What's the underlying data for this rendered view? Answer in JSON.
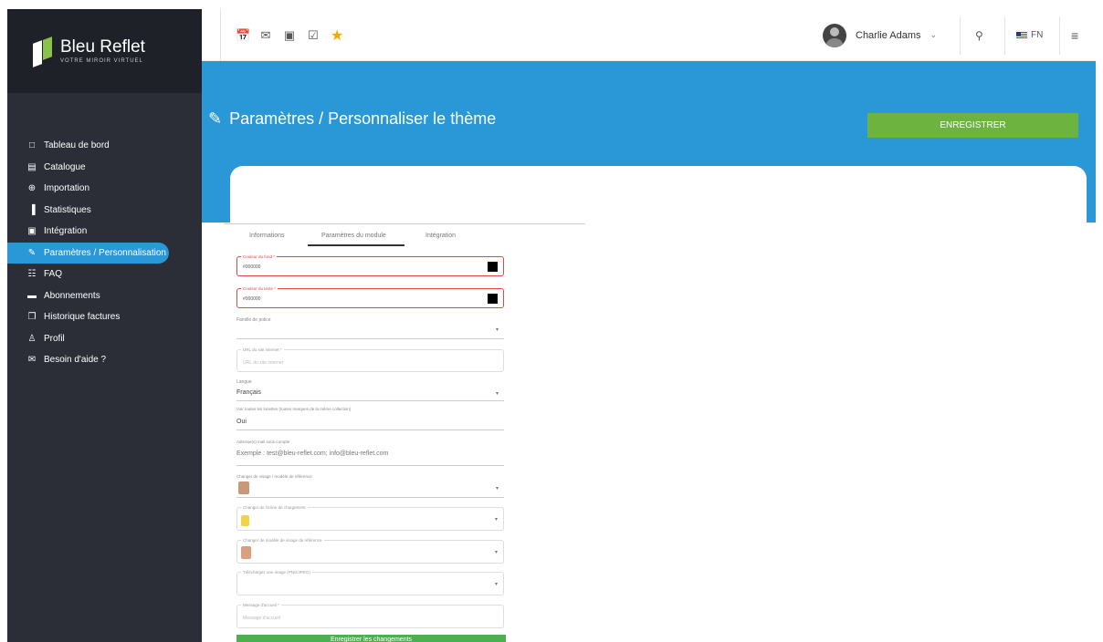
{
  "brand": {
    "name": "Bleu Reflet",
    "tagline": "VOTRE MIROIR VIRTUEL"
  },
  "sidebar": {
    "items": [
      {
        "label": "Tableau de bord",
        "icon": "clipboard-icon",
        "glyph": "□"
      },
      {
        "label": "Catalogue",
        "icon": "catalog-icon",
        "glyph": "▤"
      },
      {
        "label": "Importation",
        "icon": "import-icon",
        "glyph": "⊕"
      },
      {
        "label": "Statistiques",
        "icon": "bar-chart-icon",
        "glyph": "▐"
      },
      {
        "label": "Intégration",
        "icon": "integration-icon",
        "glyph": "▣"
      },
      {
        "label": "Paramètres / Personnalisation",
        "icon": "edit-icon",
        "glyph": "✎"
      },
      {
        "label": "FAQ",
        "icon": "chat-icon",
        "glyph": "☷"
      },
      {
        "label": "Abonnements",
        "icon": "card-icon",
        "glyph": "▬"
      },
      {
        "label": "Historique factures",
        "icon": "invoice-icon",
        "glyph": "❐"
      },
      {
        "label": "Profil",
        "icon": "user-icon",
        "glyph": "♙"
      },
      {
        "label": "Besoin d'aide ?",
        "icon": "mail-icon",
        "glyph": "✉"
      }
    ],
    "active_index": 5
  },
  "topbar": {
    "quick_icons": [
      "calendar-icon",
      "mail-icon",
      "contact-icon",
      "checkbox-icon",
      "star-icon"
    ],
    "user_name": "Charlie Adams",
    "language": "FN"
  },
  "page": {
    "title": "Paramètres / Personnaliser le thème",
    "save_label": "ENREGISTRER"
  },
  "tabs": [
    "Informations",
    "Paramètres du module",
    "Intégration"
  ],
  "active_tab": 1,
  "form": {
    "bg_color": {
      "label": "Couleur du fond *",
      "value": "#000000"
    },
    "text_color": {
      "label": "Couleur du texte *",
      "value": "#000000"
    },
    "font": {
      "label": "Famille de police",
      "value": ""
    },
    "url": {
      "label": "URL du site internet *",
      "placeholder": "URL du site internet"
    },
    "language": {
      "label": "Langue",
      "value": "Français"
    },
    "show_all": {
      "label": "Voir toutes les lunettes (toutes marques de la même collection)",
      "value": "Oui"
    },
    "emails": {
      "label": "Adresse(s) mail sous-compte",
      "placeholder": "Exemple : test@bleu-reflet.com; info@bleu-reflet.com"
    },
    "model_image": {
      "label": "Changer de visage / modèle de référence"
    },
    "loader_image": {
      "label": "Changer de l'icône de chargement"
    },
    "user_image": {
      "label": "Changer de modèle de visage de référence"
    },
    "upload_image": {
      "label": "Téléchargez une image (PNG/JPEG)"
    },
    "message": {
      "label": "Message d'accueil *",
      "placeholder": "Message d'accueil"
    },
    "submit_label": "Enregistrer les changements"
  }
}
